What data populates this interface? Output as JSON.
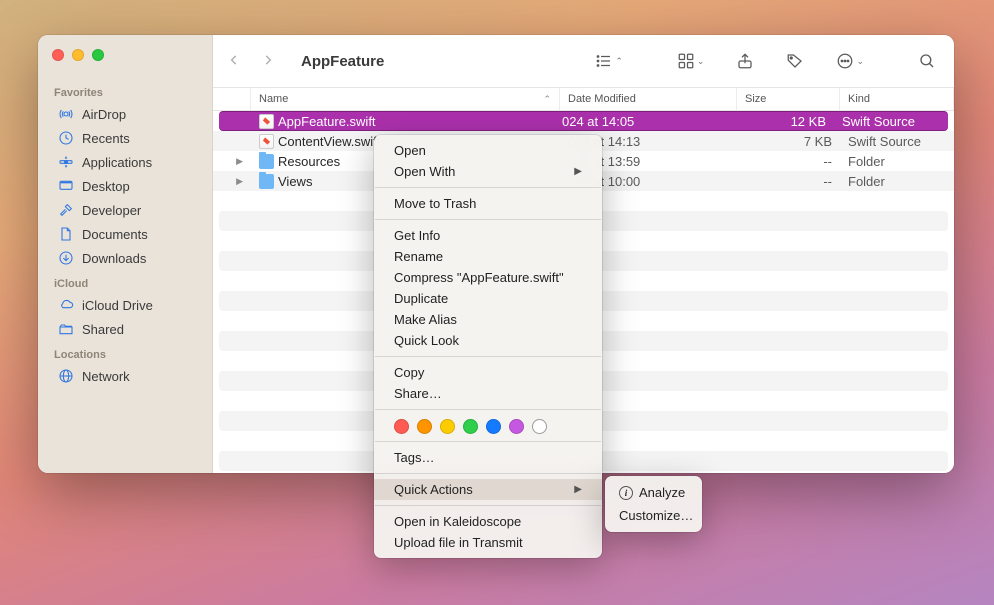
{
  "window": {
    "title": "AppFeature"
  },
  "sidebar": {
    "sections": [
      {
        "label": "Favorites",
        "items": [
          {
            "icon": "airdrop",
            "label": "AirDrop"
          },
          {
            "icon": "recents",
            "label": "Recents"
          },
          {
            "icon": "apps",
            "label": "Applications"
          },
          {
            "icon": "desktop",
            "label": "Desktop"
          },
          {
            "icon": "hammer",
            "label": "Developer"
          },
          {
            "icon": "doc",
            "label": "Documents"
          },
          {
            "icon": "download",
            "label": "Downloads"
          }
        ]
      },
      {
        "label": "iCloud",
        "items": [
          {
            "icon": "cloud",
            "label": "iCloud Drive"
          },
          {
            "icon": "shared",
            "label": "Shared"
          }
        ]
      },
      {
        "label": "Locations",
        "items": [
          {
            "icon": "globe",
            "label": "Network"
          }
        ]
      }
    ]
  },
  "columns": {
    "name": "Name",
    "date": "Date Modified",
    "size": "Size",
    "kind": "Kind"
  },
  "files": [
    {
      "name": "AppFeature.swift",
      "date": "024 at 14:05",
      "size": "12 KB",
      "kind": "Swift Source",
      "type": "swift",
      "selected": true,
      "expandable": false
    },
    {
      "name": "ContentView.swift",
      "date": "024 at 14:13",
      "size": "7 KB",
      "kind": "Swift Source",
      "type": "swift",
      "selected": false,
      "expandable": false
    },
    {
      "name": "Resources",
      "date": "024 at 13:59",
      "size": "--",
      "kind": "Folder",
      "type": "folder",
      "selected": false,
      "expandable": true
    },
    {
      "name": "Views",
      "date": "024 at 10:00",
      "size": "--",
      "kind": "Folder",
      "type": "folder",
      "selected": false,
      "expandable": true
    }
  ],
  "context_menu": {
    "groups": [
      [
        {
          "label": "Open"
        },
        {
          "label": "Open With",
          "submenu": true
        }
      ],
      [
        {
          "label": "Move to Trash"
        }
      ],
      [
        {
          "label": "Get Info"
        },
        {
          "label": "Rename"
        },
        {
          "label": "Compress \"AppFeature.swift\""
        },
        {
          "label": "Duplicate"
        },
        {
          "label": "Make Alias"
        },
        {
          "label": "Quick Look"
        }
      ],
      [
        {
          "label": "Copy"
        },
        {
          "label": "Share…"
        }
      ],
      "tags",
      [
        {
          "label": "Tags…"
        }
      ],
      [
        {
          "label": "Quick Actions",
          "submenu": true,
          "hover": true
        }
      ],
      [
        {
          "label": "Open in Kaleidoscope"
        },
        {
          "label": "Upload file in Transmit"
        }
      ]
    ],
    "tag_colors": [
      "#ff5b52",
      "#fe9500",
      "#fdcc00",
      "#2fce4b",
      "#147bff",
      "#c558e0"
    ]
  },
  "quick_actions_submenu": {
    "items": [
      {
        "icon": "info",
        "label": "Analyze"
      },
      {
        "label": "Customize…"
      }
    ]
  }
}
